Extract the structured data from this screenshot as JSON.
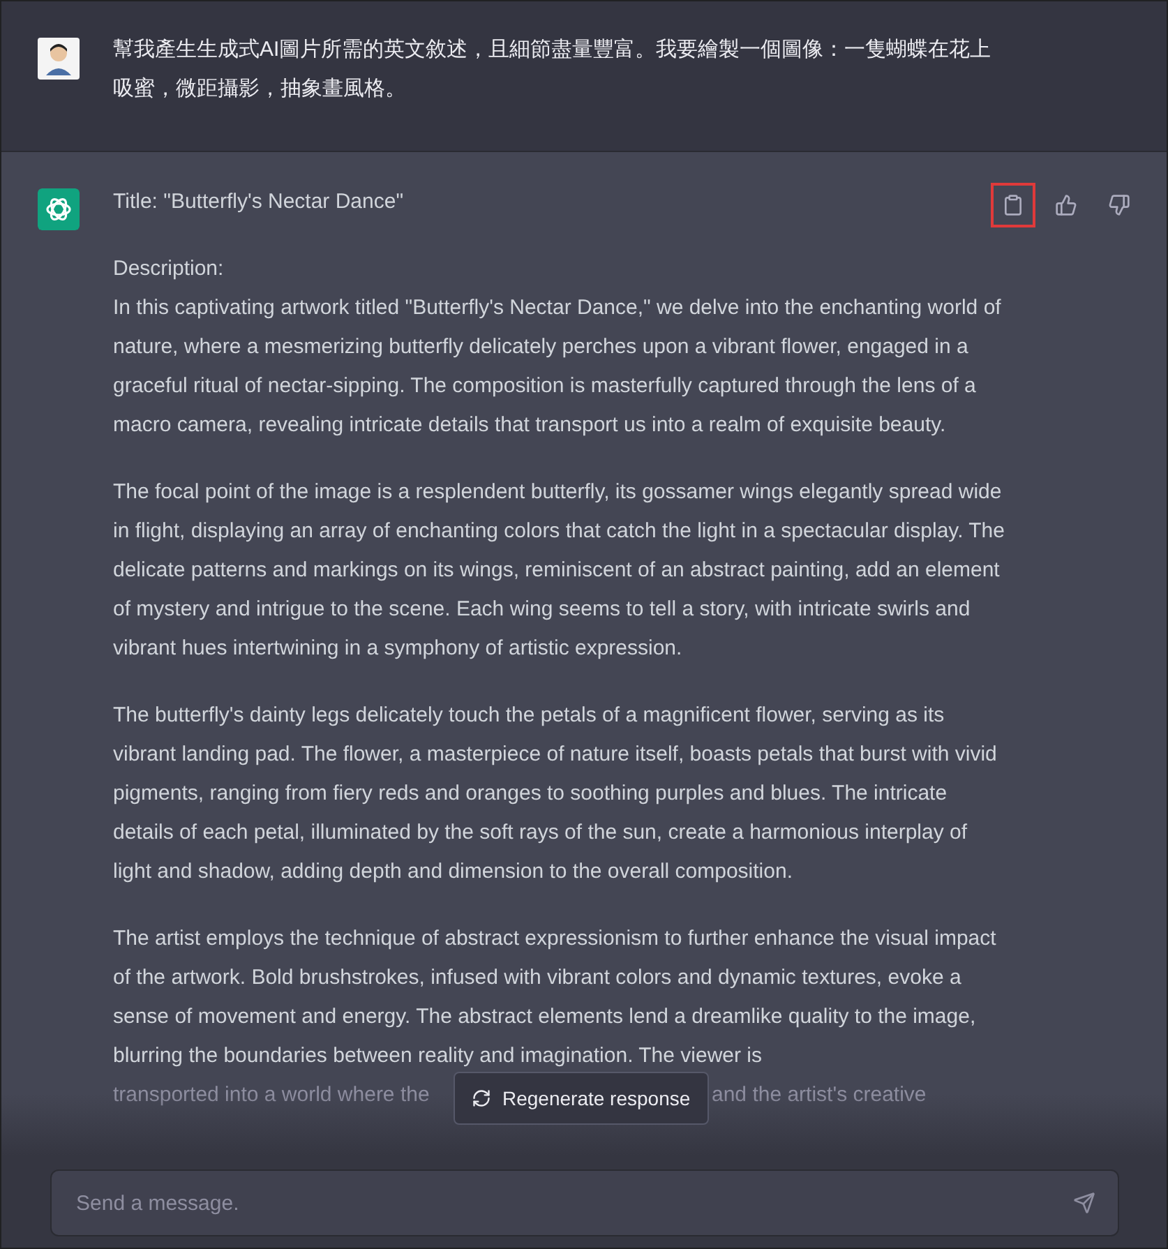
{
  "user_message": {
    "text": "幫我產生生成式AI圖片所需的英文敘述，且細節盡量豐富。我要繪製一個圖像：一隻蝴蝶在花上吸蜜，微距攝影，抽象畫風格。"
  },
  "assistant_message": {
    "title": "Title: \"Butterfly's Nectar Dance\"",
    "description_label": "Description:",
    "paragraphs": [
      "In this captivating artwork titled \"Butterfly's Nectar Dance,\" we delve into the enchanting world of nature, where a mesmerizing butterfly delicately perches upon a vibrant flower, engaged in a graceful ritual of nectar-sipping. The composition is masterfully captured through the lens of a macro camera, revealing intricate details that transport us into a realm of exquisite beauty.",
      "The focal point of the image is a resplendent butterfly, its gossamer wings elegantly spread wide in flight, displaying an array of enchanting colors that catch the light in a spectacular display. The delicate patterns and markings on its wings, reminiscent of an abstract painting, add an element of mystery and intrigue to the scene. Each wing seems to tell a story, with intricate swirls and vibrant hues intertwining in a symphony of artistic expression.",
      "The butterfly's dainty legs delicately touch the petals of a magnificent flower, serving as its vibrant landing pad. The flower, a masterpiece of nature itself, boasts petals that burst with vivid pigments, ranging from fiery reds and oranges to soothing purples and blues. The intricate details of each petal, illuminated by the soft rays of the sun, create a harmonious interplay of light and shadow, adding depth and dimension to the overall composition.",
      "The artist employs the technique of abstract expressionism to further enhance the visual impact of the artwork. Bold brushstrokes, infused with vibrant colors and dynamic textures, evoke a sense of movement and energy. The abstract elements lend a dreamlike quality to the image, blurring the boundaries between reality and imagination. The viewer is"
    ],
    "faded_line": [
      "transported into a world where the",
      "and the artist's creative"
    ]
  },
  "actions": [
    {
      "kind": "copy",
      "highlighted": true
    },
    {
      "kind": "like",
      "highlighted": false
    },
    {
      "kind": "dislike",
      "highlighted": false
    }
  ],
  "regenerate_button": "Regenerate response",
  "composer": {
    "placeholder": "Send a message."
  }
}
